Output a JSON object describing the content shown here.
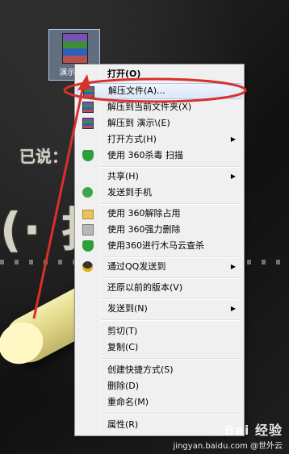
{
  "desktop": {
    "icon_label": "演示.rar",
    "chalk_text_1": "已说：",
    "chalk_text_2": "(· 払"
  },
  "menu": {
    "items": [
      {
        "label": "打开(O)",
        "bold": true
      },
      {
        "label": "解压文件(A)...",
        "icon": "winrar-icon",
        "highlighted": true
      },
      {
        "label": "解压到当前文件夹(X)",
        "icon": "winrar-icon"
      },
      {
        "label": "解压到 演示\\(E)",
        "icon": "winrar-icon"
      },
      {
        "label": "打开方式(H)",
        "submenu": true
      },
      {
        "label": "使用 360杀毒 扫描",
        "icon": "360-shield-icon"
      },
      {
        "label": "共享(H)",
        "submenu": true
      },
      {
        "label": "发送到手机",
        "icon": "phone-send-icon"
      },
      {
        "label": "使用 360解除占用",
        "icon": "360-folder-icon"
      },
      {
        "label": "使用 360强力删除",
        "icon": "360-delete-icon"
      },
      {
        "label": "使用360进行木马云查杀",
        "icon": "360-trojan-icon"
      },
      {
        "label": "通过QQ发送到",
        "icon": "qq-icon",
        "submenu": true
      },
      {
        "label": "还原以前的版本(V)"
      },
      {
        "label": "发送到(N)",
        "submenu": true
      },
      {
        "label": "剪切(T)"
      },
      {
        "label": "复制(C)"
      },
      {
        "label": "创建快捷方式(S)"
      },
      {
        "label": "删除(D)"
      },
      {
        "label": "重命名(M)"
      },
      {
        "label": "属性(R)"
      }
    ]
  },
  "watermark": {
    "logo": "Bai 经验",
    "url": "jingyan.baidu.com",
    "author": "@世外云"
  },
  "colors": {
    "annotation": "#d8302a",
    "menu_bg": "#f0f0f0",
    "highlight_border": "#aeccf1"
  }
}
